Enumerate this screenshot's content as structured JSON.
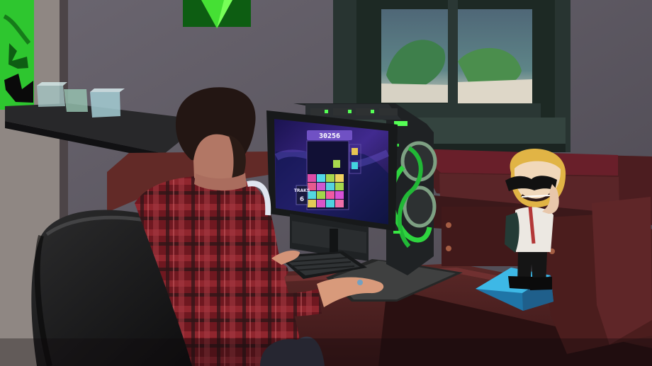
{
  "scene": {
    "name": "sims-gaming-computer-scene"
  },
  "monitor": {
    "score": "30256",
    "level_label": "TRAKS",
    "level_value": "6"
  },
  "colors": {
    "wall": "#5b5862",
    "desk": "#4a1f1f",
    "desk_dark": "#351516",
    "computer_dark": "#24272a",
    "accent_green": "#34d641",
    "screen_bg": "#21164f",
    "shirt_red": "#7e1f26",
    "base_blue": "#2ea9d7"
  }
}
